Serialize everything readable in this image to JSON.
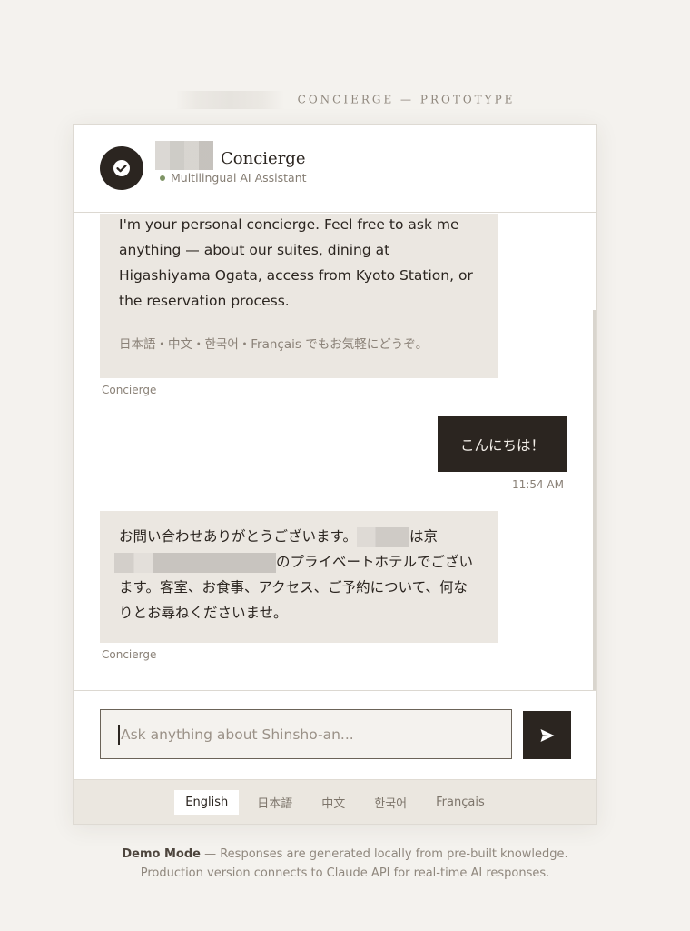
{
  "eyebrow": {
    "label": "CONCIERGE — PROTOTYPE"
  },
  "header": {
    "brand": "Concierge",
    "status": "Multilingual AI Assistant",
    "status_color": "#7e9465"
  },
  "messages": [
    {
      "role": "bot",
      "text": "I'm your personal concierge. Feel free to ask me anything — about our suites, dining at Higashiyama Ogata, access from Kyoto Station, or the reservation process.",
      "subtext": "日本語・中文・한국어・Français でもお気軽にどうぞ。",
      "sender": "Concierge"
    },
    {
      "role": "user",
      "text": "こんにちは！",
      "time": "11:54 AM"
    },
    {
      "role": "bot",
      "text_part1": "お問い合わせありがとうございます。",
      "text_part2": "は京",
      "text_part3": "のプライベートホテルでございます。客室、お食事、アクセス、ご予約について、何なりとお尋ねくださいませ。",
      "sender": "Concierge"
    }
  ],
  "composer": {
    "placeholder": "Ask anything about Shinsho-an...",
    "send_icon": "send-icon"
  },
  "languages": [
    {
      "label": "English",
      "active": true
    },
    {
      "label": "日本語",
      "active": false
    },
    {
      "label": "中文",
      "active": false
    },
    {
      "label": "한국어",
      "active": false
    },
    {
      "label": "Français",
      "active": false
    }
  ],
  "footer": {
    "mode_label": "Demo Mode",
    "line1_rest": " — Responses are generated locally from pre-built knowledge.",
    "line2": "Production version connects to Claude API for real-time AI responses."
  },
  "colors": {
    "background": "#f4f2ee",
    "dark": "#2b2520",
    "bubble": "#ebe7e1",
    "accent_green": "#7e9465"
  }
}
